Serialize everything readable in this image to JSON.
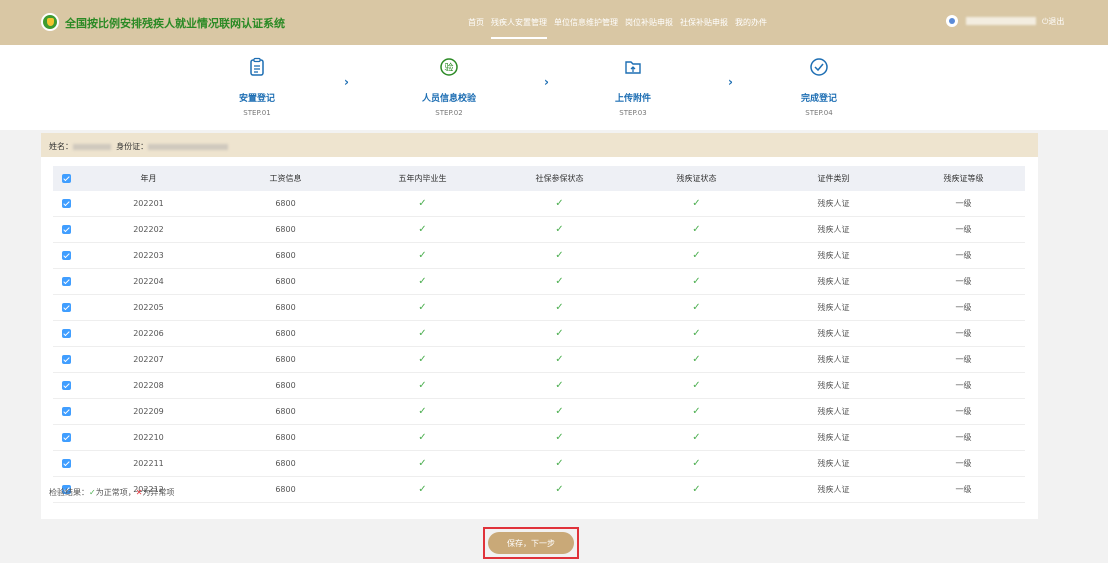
{
  "header": {
    "title": "全国按比例安排残疾人就业情况联网认证系统",
    "nav": [
      "首页",
      "残疾人安置管理",
      "单位信息维护管理",
      "岗位补贴申报",
      "社保补贴申报",
      "我的办件"
    ],
    "active_nav": "残疾人安置管理",
    "logout": "退出"
  },
  "steps": [
    {
      "label": "安置登记",
      "sub": "STEP.01",
      "icon": "clipboard-icon"
    },
    {
      "label": "人员信息校验",
      "sub": "STEP.02",
      "icon": "verify-icon"
    },
    {
      "label": "上传附件",
      "sub": "STEP.03",
      "icon": "upload-icon"
    },
    {
      "label": "完成登记",
      "sub": "STEP.04",
      "icon": "check-circle-icon"
    }
  ],
  "person": {
    "name_label": "姓名：",
    "id_label": "身份证："
  },
  "table": {
    "headers": [
      "年月",
      "工资信息",
      "五年内毕业生",
      "社保参保状态",
      "残疾证状态",
      "证件类别",
      "残疾证等级"
    ],
    "rows": [
      {
        "ym": "202201",
        "salary": "6800",
        "type": "残疾人证",
        "level": "一级"
      },
      {
        "ym": "202202",
        "salary": "6800",
        "type": "残疾人证",
        "level": "一级"
      },
      {
        "ym": "202203",
        "salary": "6800",
        "type": "残疾人证",
        "level": "一级"
      },
      {
        "ym": "202204",
        "salary": "6800",
        "type": "残疾人证",
        "level": "一级"
      },
      {
        "ym": "202205",
        "salary": "6800",
        "type": "残疾人证",
        "level": "一级"
      },
      {
        "ym": "202206",
        "salary": "6800",
        "type": "残疾人证",
        "level": "一级"
      },
      {
        "ym": "202207",
        "salary": "6800",
        "type": "残疾人证",
        "level": "一级"
      },
      {
        "ym": "202208",
        "salary": "6800",
        "type": "残疾人证",
        "level": "一级"
      },
      {
        "ym": "202209",
        "salary": "6800",
        "type": "残疾人证",
        "level": "一级"
      },
      {
        "ym": "202210",
        "salary": "6800",
        "type": "残疾人证",
        "level": "一级"
      },
      {
        "ym": "202211",
        "salary": "6800",
        "type": "残疾人证",
        "level": "一级"
      },
      {
        "ym": "202212",
        "salary": "6800",
        "type": "残疾人证",
        "level": "一级"
      }
    ],
    "check_mark": "✓"
  },
  "legend": {
    "label": "检验结果：",
    "ok_mark": "✓",
    "ok_text": "为正常项，",
    "bad_mark": "✕",
    "bad_text": "为异常项"
  },
  "save_button": "保存，下一步",
  "colors": {
    "topbar": "#d9c7a4",
    "brand_green": "#2b8a25",
    "step_blue": "#1d6eb3",
    "check_green": "#4caf50",
    "highlight_red": "#e0323a"
  }
}
